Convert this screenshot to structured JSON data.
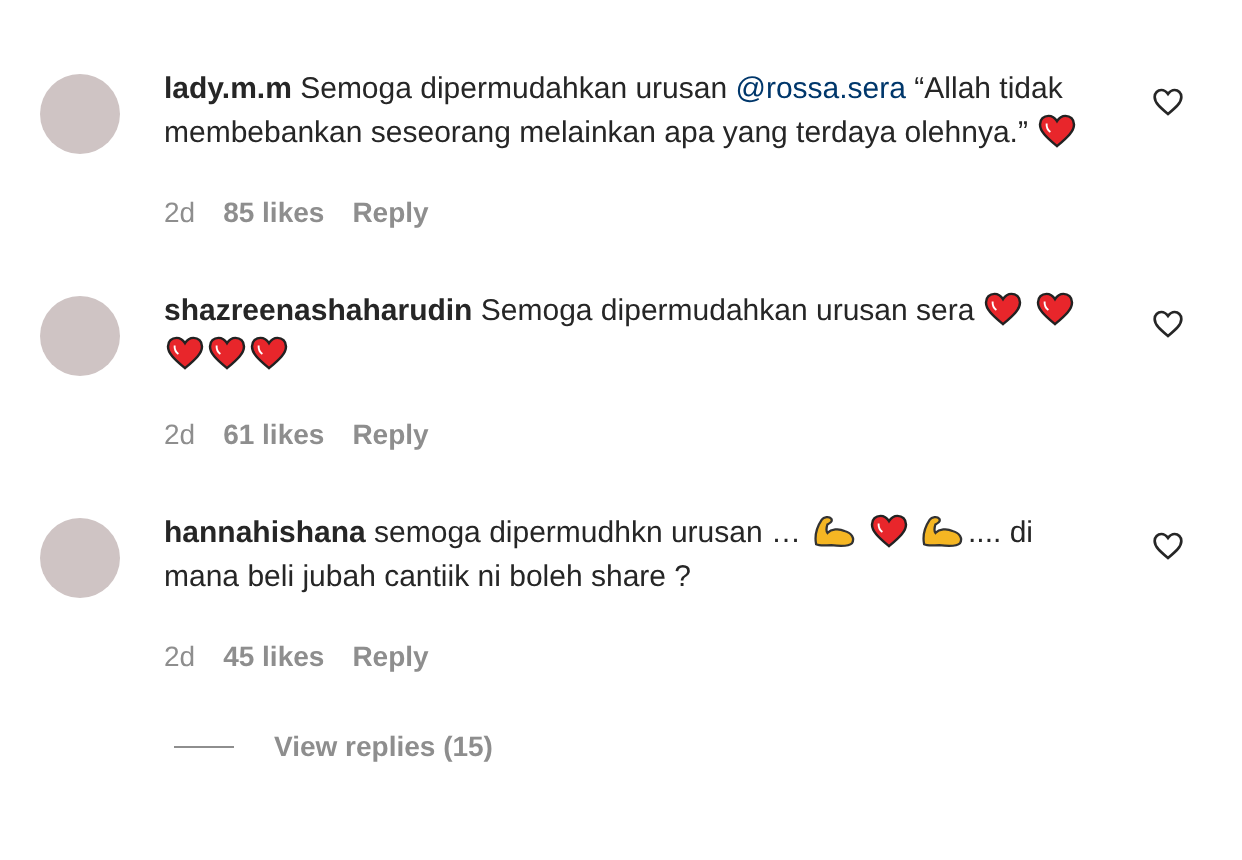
{
  "comments": [
    {
      "username": "lady.m.m",
      "segments": [
        {
          "kind": "text",
          "text": "Semoga dipermudahkan urusan "
        },
        {
          "kind": "mention",
          "text": "@rossa.sera"
        },
        {
          "kind": "text",
          "text": " “Allah tidak membebankan seseorang melainkan apa yang terdaya olehnya.” "
        },
        {
          "kind": "heart"
        }
      ],
      "age": "2d",
      "likes": "85 likes",
      "reply": "Reply"
    },
    {
      "username": "shazreenashaharudin",
      "segments": [
        {
          "kind": "text",
          "text": "Semoga dipermudahkan urusan sera "
        },
        {
          "kind": "heart"
        },
        {
          "kind": "space"
        },
        {
          "kind": "heart"
        },
        {
          "kind": "heart"
        },
        {
          "kind": "heart"
        },
        {
          "kind": "heart"
        }
      ],
      "age": "2d",
      "likes": "61 likes",
      "reply": "Reply"
    },
    {
      "username": "hannahishana",
      "segments": [
        {
          "kind": "text",
          "text": "semoga dipermudhkn urusan … "
        },
        {
          "kind": "muscle"
        },
        {
          "kind": "space"
        },
        {
          "kind": "heart"
        },
        {
          "kind": "space"
        },
        {
          "kind": "muscle"
        },
        {
          "kind": "text",
          "text": ".... di mana beli jubah cantiik ni boleh share ?"
        }
      ],
      "age": "2d",
      "likes": "45 likes",
      "reply": "Reply"
    }
  ],
  "view_replies": "View replies (15)"
}
